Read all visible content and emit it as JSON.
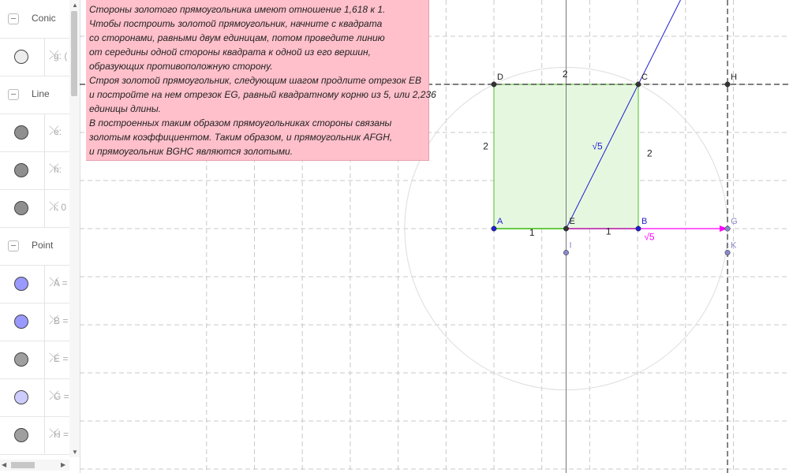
{
  "algebra": {
    "groups": [
      {
        "name": "Conic",
        "items": [
          {
            "text": "g: (",
            "color": "#ededed"
          }
        ]
      },
      {
        "name": "Line",
        "items": [
          {
            "text": "e: ",
            "color": "#8f8f8f"
          },
          {
            "text": "h: ",
            "color": "#8f8f8f"
          },
          {
            "text": "i: 0",
            "color": "#8f8f8f"
          }
        ]
      },
      {
        "name": "Point",
        "items": [
          {
            "text": "A = ",
            "color": "#9999ff"
          },
          {
            "text": "B = ",
            "color": "#9999ff"
          },
          {
            "text": "E = ",
            "color": "#9f9f9f"
          },
          {
            "text": "G = ",
            "color": "#ccccff"
          },
          {
            "text": "H = ",
            "color": "#9f9f9f"
          }
        ]
      }
    ]
  },
  "textbox": {
    "lines": [
      "Стороны золотого прямоугольника имеют отношение 1,618 к 1.",
      "Чтобы построить золотой прямоугольник, начните с квадрата",
      " со сторонами, равными двум единицам, потом проведите линию",
      " от середины одной стороны квадрата к одной из его вершин,",
      "образующих противоположную сторону.",
      "Строя золотой прямоугольник, следующим шагом продлите отрезок EB",
      " и постройте на нем отрезок EG, равный квадратному корню из 5, или 2,236",
      " единицы длины.",
      "В построенных таким образом прямоугольниках стороны связаны",
      "золотым коэффициентом. Таким образом, и прямоугольник AFGH,",
      "и прямоугольник BGHC являются золотыми."
    ]
  },
  "geometry": {
    "points": [
      {
        "name": "A",
        "x": 0,
        "y": 0
      },
      {
        "name": "B",
        "x": 2,
        "y": 0
      },
      {
        "name": "C",
        "x": 2,
        "y": 2
      },
      {
        "name": "D",
        "x": 0,
        "y": 2
      },
      {
        "name": "E",
        "x": 1,
        "y": 0
      },
      {
        "name": "G",
        "x": 3.236,
        "y": 0
      },
      {
        "name": "H",
        "x": 3.236,
        "y": 2
      },
      {
        "name": "I",
        "x": 1,
        "y": -0.333
      },
      {
        "name": "K",
        "x": 3.236,
        "y": -0.333
      }
    ],
    "edge_labels": [
      {
        "text": "2",
        "x": 0.95,
        "y": 2.1
      },
      {
        "text": "2",
        "x": -0.15,
        "y": 1.1
      },
      {
        "text": "2",
        "x": 2.12,
        "y": 1.0
      },
      {
        "text": "√5",
        "x": 1.36,
        "y": 1.1
      },
      {
        "text": "1",
        "x": 0.49,
        "y": -0.1
      },
      {
        "text": "1",
        "x": 1.55,
        "y": -0.08
      },
      {
        "text": "√5",
        "x": 2.08,
        "y": -0.16
      }
    ],
    "colors": {
      "square_fill": "#e6f7e0",
      "square_stroke": "#66cc44",
      "diagonal": "#1f1fd0",
      "vector": "#ff00ff",
      "circle": "#dddddd",
      "point_blue": "#1f1fd0",
      "point_dark": "#333333",
      "point_light": "#8888cc"
    }
  }
}
